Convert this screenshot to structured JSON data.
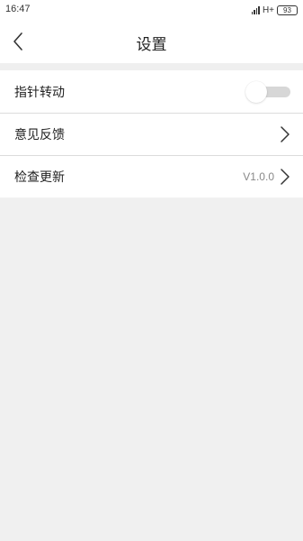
{
  "status_bar": {
    "time": "16:47",
    "network": "H+",
    "battery": "93"
  },
  "header": {
    "title": "设置",
    "back_icon": "chevron-left-icon"
  },
  "settings": {
    "items": [
      {
        "label": "指针转动",
        "type": "toggle",
        "state": "off",
        "value": ""
      },
      {
        "label": "意见反馈",
        "type": "link",
        "value": ""
      },
      {
        "label": "检查更新",
        "type": "link",
        "value": "V1.0.0"
      }
    ]
  },
  "colors": {
    "background": "#f2f2f2",
    "row_background": "#ffffff",
    "divider": "#dcdcdc",
    "toggle_track_off": "#d7d7d7",
    "secondary_text": "#888888"
  }
}
